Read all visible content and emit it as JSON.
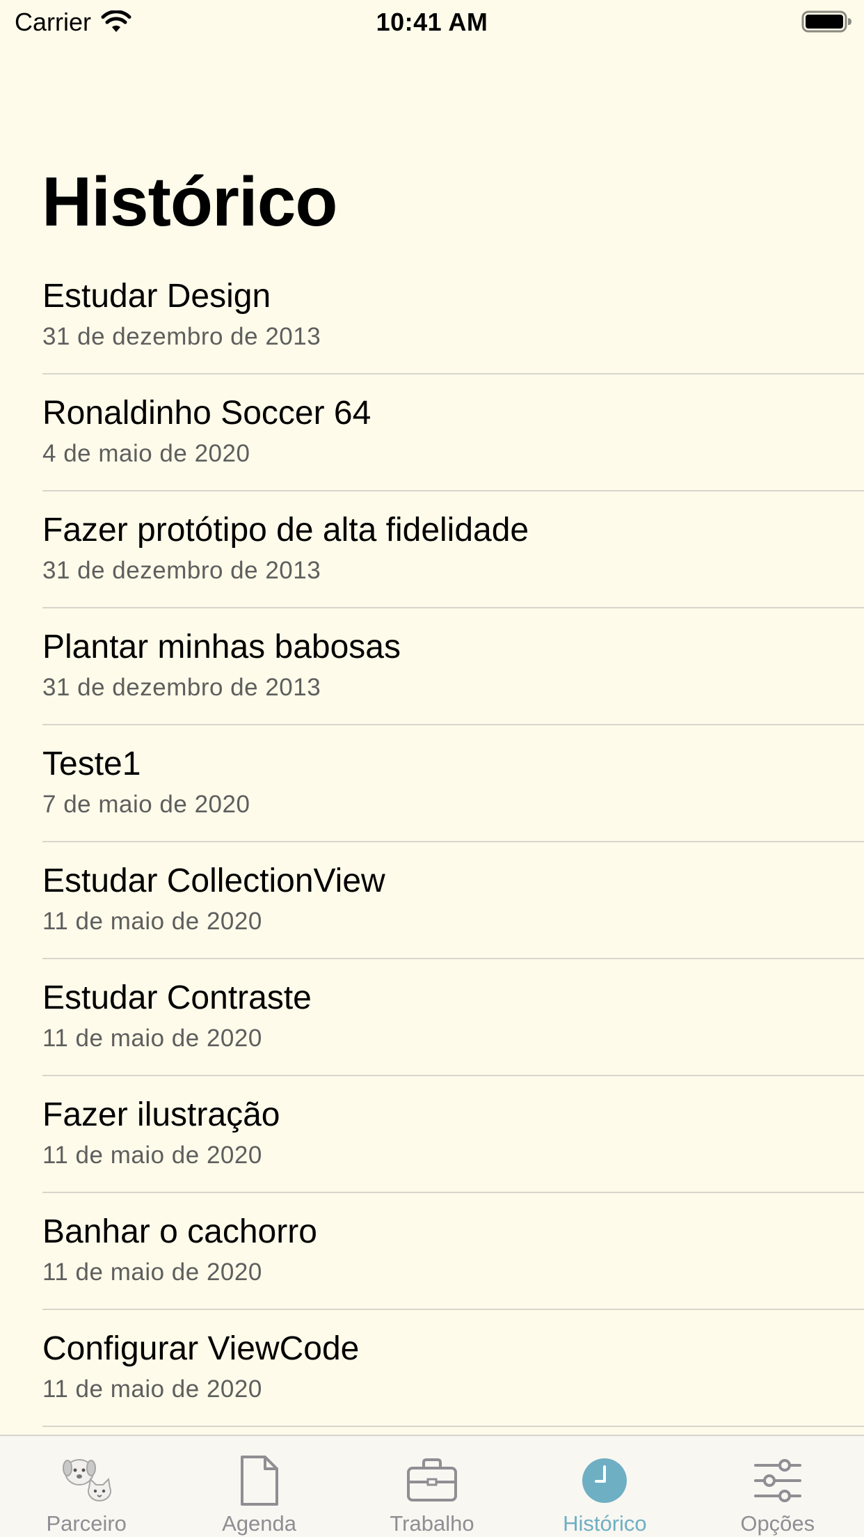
{
  "status_bar": {
    "carrier": "Carrier",
    "time": "10:41 AM",
    "wifi_icon": "wifi-icon",
    "battery_icon": "battery-icon"
  },
  "title": "Histórico",
  "items": [
    {
      "title": "Estudar Design",
      "date": "31 de dezembro de 2013"
    },
    {
      "title": "Ronaldinho Soccer 64",
      "date": "4 de maio de 2020"
    },
    {
      "title": "Fazer protótipo de alta fidelidade",
      "date": "31 de dezembro de 2013"
    },
    {
      "title": "Plantar minhas babosas",
      "date": "31 de dezembro de 2013"
    },
    {
      "title": "Teste1",
      "date": "7 de maio de 2020"
    },
    {
      "title": "Estudar CollectionView",
      "date": "11 de maio de 2020"
    },
    {
      "title": "Estudar Contraste",
      "date": "11 de maio de 2020"
    },
    {
      "title": "Fazer ilustração",
      "date": "11 de maio de 2020"
    },
    {
      "title": "Banhar o cachorro",
      "date": "11 de maio de 2020"
    },
    {
      "title": "Configurar ViewCode",
      "date": "11 de maio de 2020"
    }
  ],
  "tabs": [
    {
      "label": "Parceiro",
      "icon": "pets-icon",
      "active": false
    },
    {
      "label": "Agenda",
      "icon": "document-icon",
      "active": false
    },
    {
      "label": "Trabalho",
      "icon": "briefcase-icon",
      "active": false
    },
    {
      "label": "Histórico",
      "icon": "clock-icon",
      "active": true
    },
    {
      "label": "Opções",
      "icon": "sliders-icon",
      "active": false
    }
  ],
  "colors": {
    "background": "#FEFBEA",
    "accent": "#6FAFC4",
    "tab_inactive": "#8E8E93",
    "subtitle": "#5E5E5E"
  }
}
